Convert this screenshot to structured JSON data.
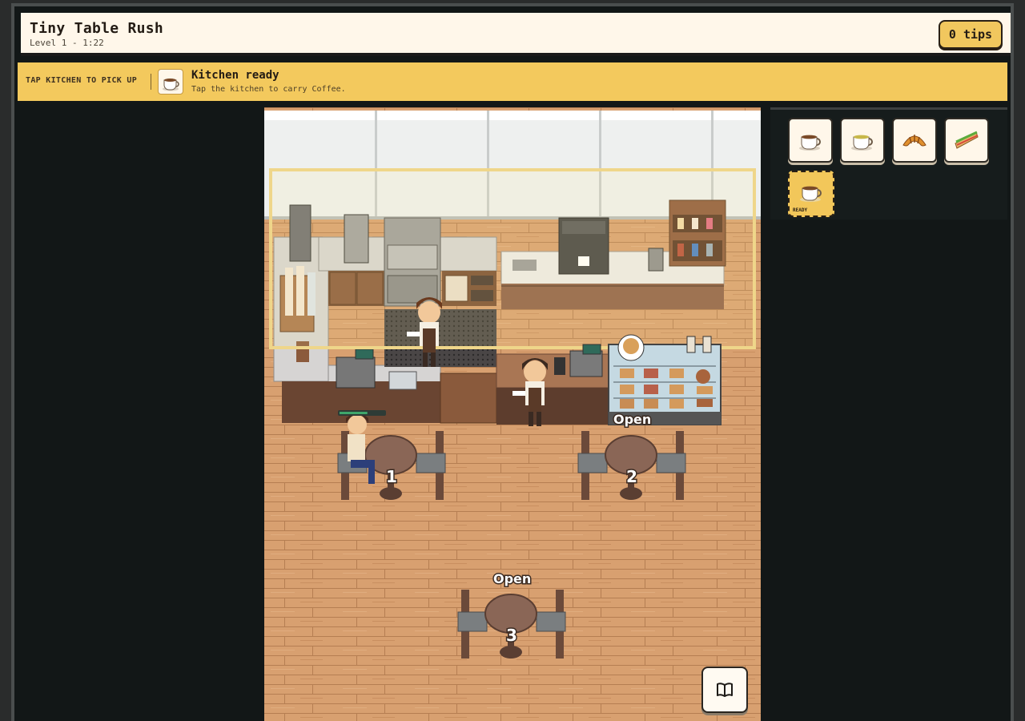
{
  "header": {
    "title": "Tiny Table Rush",
    "subtitle": "Level 1 - 1:22",
    "tips": "0 tips"
  },
  "banner": {
    "hint": "TAP KITCHEN TO PICK UP",
    "icon": "coffee-cup-icon",
    "title": "Kitchen ready",
    "subtitle": "Tap the kitchen to carry Coffee."
  },
  "menu": {
    "items": [
      {
        "icon": "coffee-cup-icon"
      },
      {
        "icon": "tea-cup-icon"
      },
      {
        "icon": "croissant-icon"
      },
      {
        "icon": "sandwich-icon"
      }
    ],
    "ready": {
      "icon": "coffee-cup-icon",
      "label": "READY"
    }
  },
  "tables": [
    {
      "number": "1",
      "status": ""
    },
    {
      "number": "2",
      "status": ""
    },
    {
      "number": "3",
      "status": "Open"
    }
  ],
  "pastry_case": {
    "status": "Open"
  },
  "customer": {
    "patience": 0.62
  },
  "book_button": {
    "icon": "book-icon"
  },
  "colors": {
    "header_bg": "#fff7ea",
    "banner_bg": "#f3c95d",
    "accent": "#f1c75e",
    "floor": "#d79e6e",
    "patience_bar": "#3fa66b"
  }
}
